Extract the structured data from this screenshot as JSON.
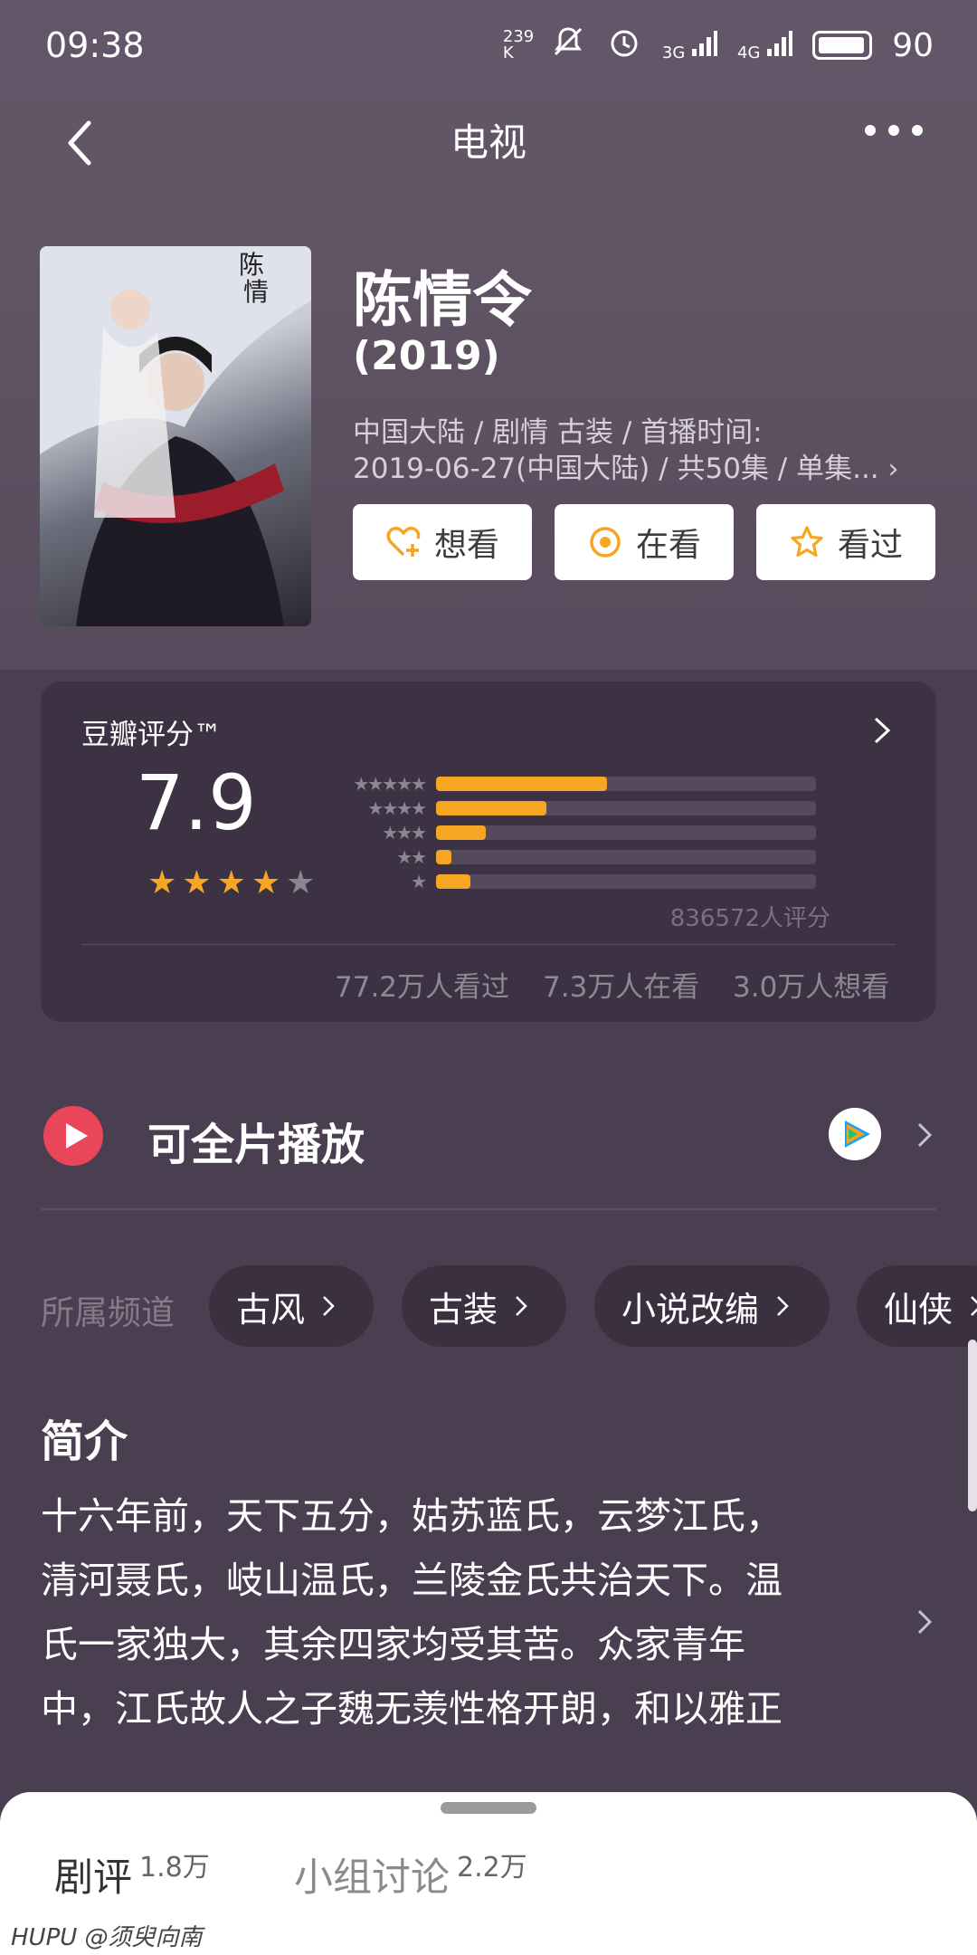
{
  "status_bar": {
    "time": "09:38",
    "net_speed": "239 K",
    "signal1": "3G",
    "signal2": "4G",
    "battery": "90"
  },
  "nav": {
    "title": "电视",
    "back_icon": "chevron-left-icon",
    "more_icon": "more-dots-icon"
  },
  "movie": {
    "title": "陈情令",
    "year": "(2019)",
    "meta_line1": "中国大陆 / 剧情 古装 / 首播时间:",
    "meta_line2": "2019-06-27(中国大陆) / 共50集 / 单集...",
    "actions": [
      {
        "label": "想看",
        "icon": "heart-plus-icon"
      },
      {
        "label": "在看",
        "icon": "target-circle-icon"
      },
      {
        "label": "看过",
        "icon": "star-outline-icon"
      }
    ]
  },
  "rating": {
    "label": "豆瓣评分™",
    "score": "7.9",
    "stars": 4,
    "distribution": [
      {
        "stars": 5,
        "percent": 45
      },
      {
        "stars": 4,
        "percent": 29
      },
      {
        "stars": 3,
        "percent": 13
      },
      {
        "stars": 2,
        "percent": 4
      },
      {
        "stars": 1,
        "percent": 9
      }
    ],
    "count_text": "836572人评分",
    "stats": {
      "watched": "77.2万人看过",
      "watching": "7.3万人在看",
      "want": "3.0万人想看"
    },
    "colors": {
      "accent": "#f6a623"
    }
  },
  "play": {
    "label": "可全片播放",
    "icon": "play-icon",
    "source_icon": "tencent-video-icon"
  },
  "channels": {
    "label": "所属频道",
    "items": [
      "古风",
      "古装",
      "小说改编",
      "仙侠"
    ]
  },
  "intro": {
    "title": "简介",
    "lines": [
      "十六年前，天下五分，姑苏蓝氏，云梦江氏，",
      "清河聂氏，岐山温氏，兰陵金氏共治天下。温",
      "氏一家独大，其余四家均受其苦。众家青年",
      "中，江氏故人之子魏无羡性格开朗，和以雅正"
    ]
  },
  "bottom_sheet": {
    "tabs": [
      {
        "label": "剧评",
        "count": "1.8万"
      },
      {
        "label": "小组讨论",
        "count": "2.2万"
      }
    ],
    "watermark": "HUPU @须臾向南"
  }
}
